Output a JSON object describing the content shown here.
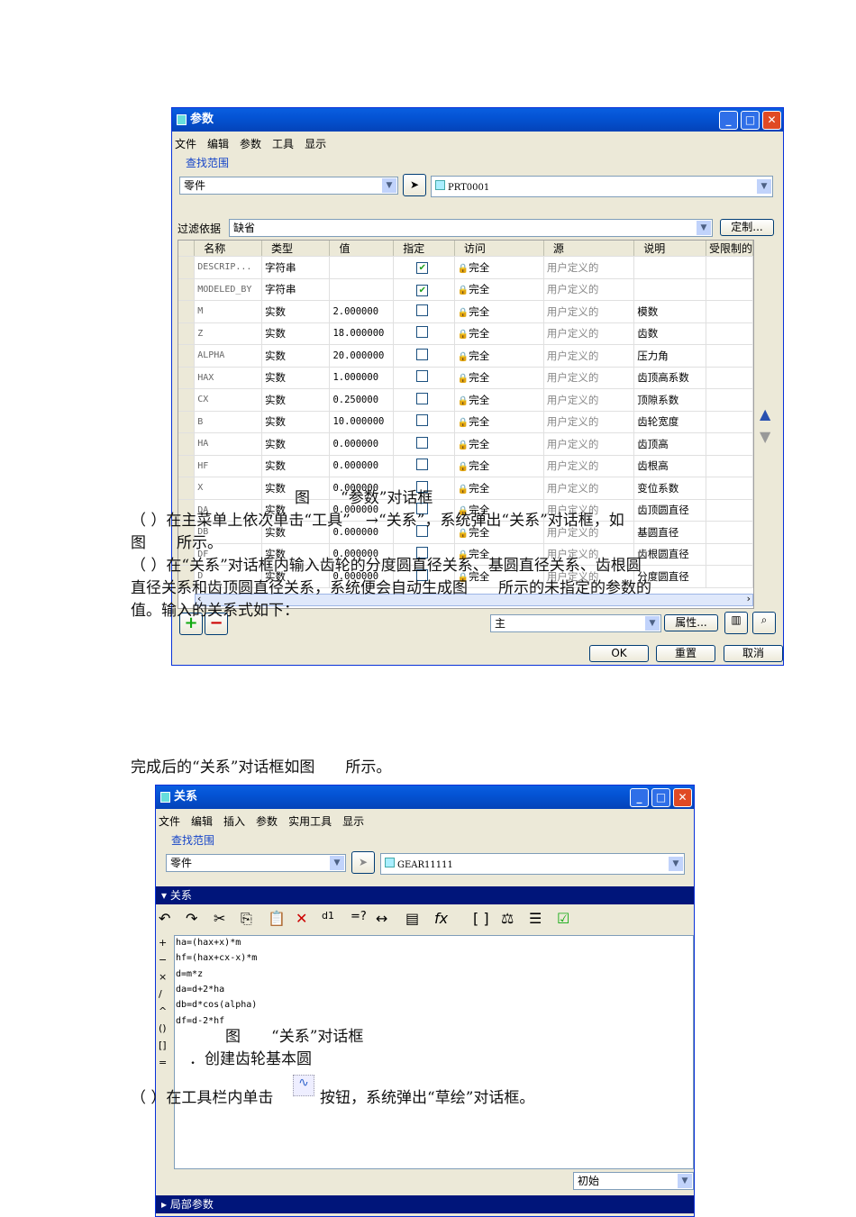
{
  "params_dialog": {
    "title": "参数",
    "menu": [
      "文件",
      "编辑",
      "参数",
      "工具",
      "显示"
    ],
    "scope_label": "查找范围",
    "scope_combo": "零件",
    "model_combo": "PRT0001",
    "filter_label": "过滤依据",
    "filter_combo": "缺省",
    "customize_button": "定制...",
    "columns": [
      "名称",
      "类型",
      "值",
      "指定",
      "访问",
      "源",
      "说明",
      "受限制的"
    ],
    "rows": [
      {
        "name": "DESCRIP...",
        "type": "字符串",
        "value": "",
        "designated": true,
        "access": "完全",
        "source": "用户定义的",
        "desc": ""
      },
      {
        "name": "MODELED_BY",
        "type": "字符串",
        "value": "",
        "designated": true,
        "access": "完全",
        "source": "用户定义的",
        "desc": ""
      },
      {
        "name": "M",
        "type": "实数",
        "value": "2.000000",
        "designated": false,
        "access": "完全",
        "source": "用户定义的",
        "desc": "模数"
      },
      {
        "name": "Z",
        "type": "实数",
        "value": "18.000000",
        "designated": false,
        "access": "完全",
        "source": "用户定义的",
        "desc": "齿数"
      },
      {
        "name": "ALPHA",
        "type": "实数",
        "value": "20.000000",
        "designated": false,
        "access": "完全",
        "source": "用户定义的",
        "desc": "压力角"
      },
      {
        "name": "HAX",
        "type": "实数",
        "value": "1.000000",
        "designated": false,
        "access": "完全",
        "source": "用户定义的",
        "desc": "齿顶高系数"
      },
      {
        "name": "CX",
        "type": "实数",
        "value": "0.250000",
        "designated": false,
        "access": "完全",
        "source": "用户定义的",
        "desc": "顶隙系数"
      },
      {
        "name": "B",
        "type": "实数",
        "value": "10.000000",
        "designated": false,
        "access": "完全",
        "source": "用户定义的",
        "desc": "齿轮宽度"
      },
      {
        "name": "HA",
        "type": "实数",
        "value": "0.000000",
        "designated": false,
        "access": "完全",
        "source": "用户定义的",
        "desc": "齿顶高"
      },
      {
        "name": "HF",
        "type": "实数",
        "value": "0.000000",
        "designated": false,
        "access": "完全",
        "source": "用户定义的",
        "desc": "齿根高"
      },
      {
        "name": "X",
        "type": "实数",
        "value": "0.000000",
        "designated": false,
        "access": "完全",
        "source": "用户定义的",
        "desc": "变位系数"
      },
      {
        "name": "DA",
        "type": "实数",
        "value": "0.000000",
        "designated": false,
        "access": "完全",
        "source": "用户定义的",
        "desc": "齿顶圆直径"
      },
      {
        "name": "DB",
        "type": "实数",
        "value": "0.000000",
        "designated": false,
        "access": "完全",
        "source": "用户定义的",
        "desc": "基圆直径"
      },
      {
        "name": "DF",
        "type": "实数",
        "value": "0.000000",
        "designated": false,
        "access": "完全",
        "source": "用户定义的",
        "desc": "齿根圆直径"
      },
      {
        "name": "D",
        "type": "实数",
        "value": "0.000000",
        "designated": false,
        "access": "完全",
        "source": "用户定义的",
        "desc": "分度圆直径"
      }
    ],
    "set_combo": "主",
    "properties_button": "属性...",
    "ok_button": "OK",
    "reset_button": "重置",
    "cancel_button": "取消"
  },
  "doc": {
    "caption1": "图　　“参数”对话框",
    "step3_a": "（ ）在主菜单上依次单击“工具”　→“关系”，系统弹出“关系”对话框，如",
    "step3_b": "图　　所示。",
    "step4_a": "（ ）在“关系”对话框内输入齿轮的分度圆直径关系、基圆直径关系、齿根圆",
    "step4_b": "直径关系和齿顶圆直径关系，系统便会自动生成图　　所示的未指定的参数的",
    "step4_c": "值。输入的关系式如下：",
    "after": "完成后的“关系”对话框如图　　所示。",
    "caption2": "图　　“关系”对话框",
    "section": "．创建齿轮基本圆",
    "step1_a": "（ ）在工具栏内单击",
    "step1_b": "按钮，系统弹出“草绘”对话框。"
  },
  "relations_dialog": {
    "title": "关系",
    "menu": [
      "文件",
      "编辑",
      "插入",
      "参数",
      "实用工具",
      "显示"
    ],
    "scope_label": "查找范围",
    "scope_combo": "零件",
    "model_combo": "GEAR11111",
    "section_label": "关系",
    "operators": [
      "+",
      "−",
      "×",
      "/",
      "^",
      "()",
      "[]",
      "="
    ],
    "relations": [
      "ha=(hax+x)*m",
      "hf=(hax+cx-x)*m",
      "d=m*z",
      "da=d+2*ha",
      "db=d*cos(alpha)",
      "df=d-2*hf"
    ],
    "sort_combo": "初始",
    "local_params_label": "局部参数"
  }
}
